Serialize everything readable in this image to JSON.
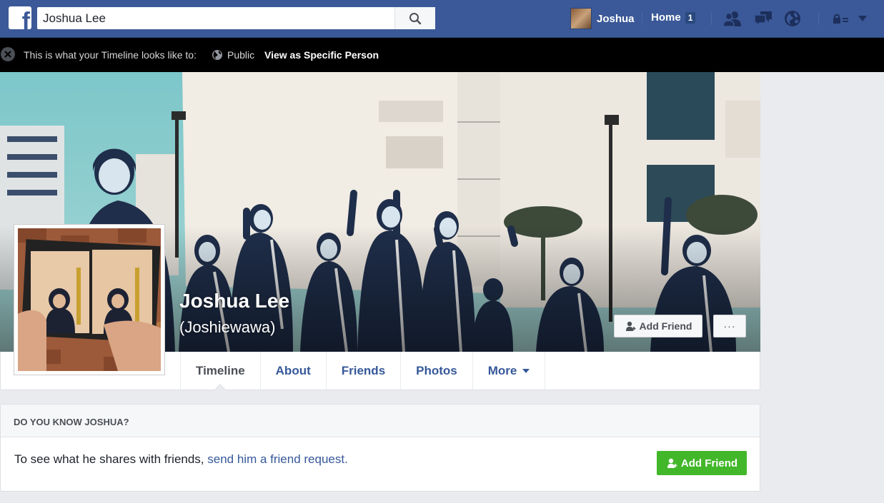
{
  "topbar": {
    "search_value": "Joshua Lee",
    "profile_name": "Joshua",
    "home_label": "Home",
    "home_count": "1"
  },
  "notice": {
    "text": "This is what your Timeline looks like to:",
    "audience": "Public",
    "link": "View as Specific Person"
  },
  "profile": {
    "name": "Joshua Lee",
    "alternate_name": "(Joshiewawa)",
    "add_friend_label": "Add Friend",
    "more_label": "···"
  },
  "tabs": [
    {
      "label": "Timeline",
      "active": true
    },
    {
      "label": "About"
    },
    {
      "label": "Friends"
    },
    {
      "label": "Photos"
    },
    {
      "label": "More"
    }
  ],
  "know_box": {
    "heading": "DO YOU KNOW JOSHUA?",
    "text": "To see what he shares with friends, ",
    "link": "send him a friend request.",
    "button_label": "Add Friend"
  },
  "colors": {
    "brand": "#3b5998",
    "link": "#365899",
    "add_friend_green": "#42b72a"
  }
}
